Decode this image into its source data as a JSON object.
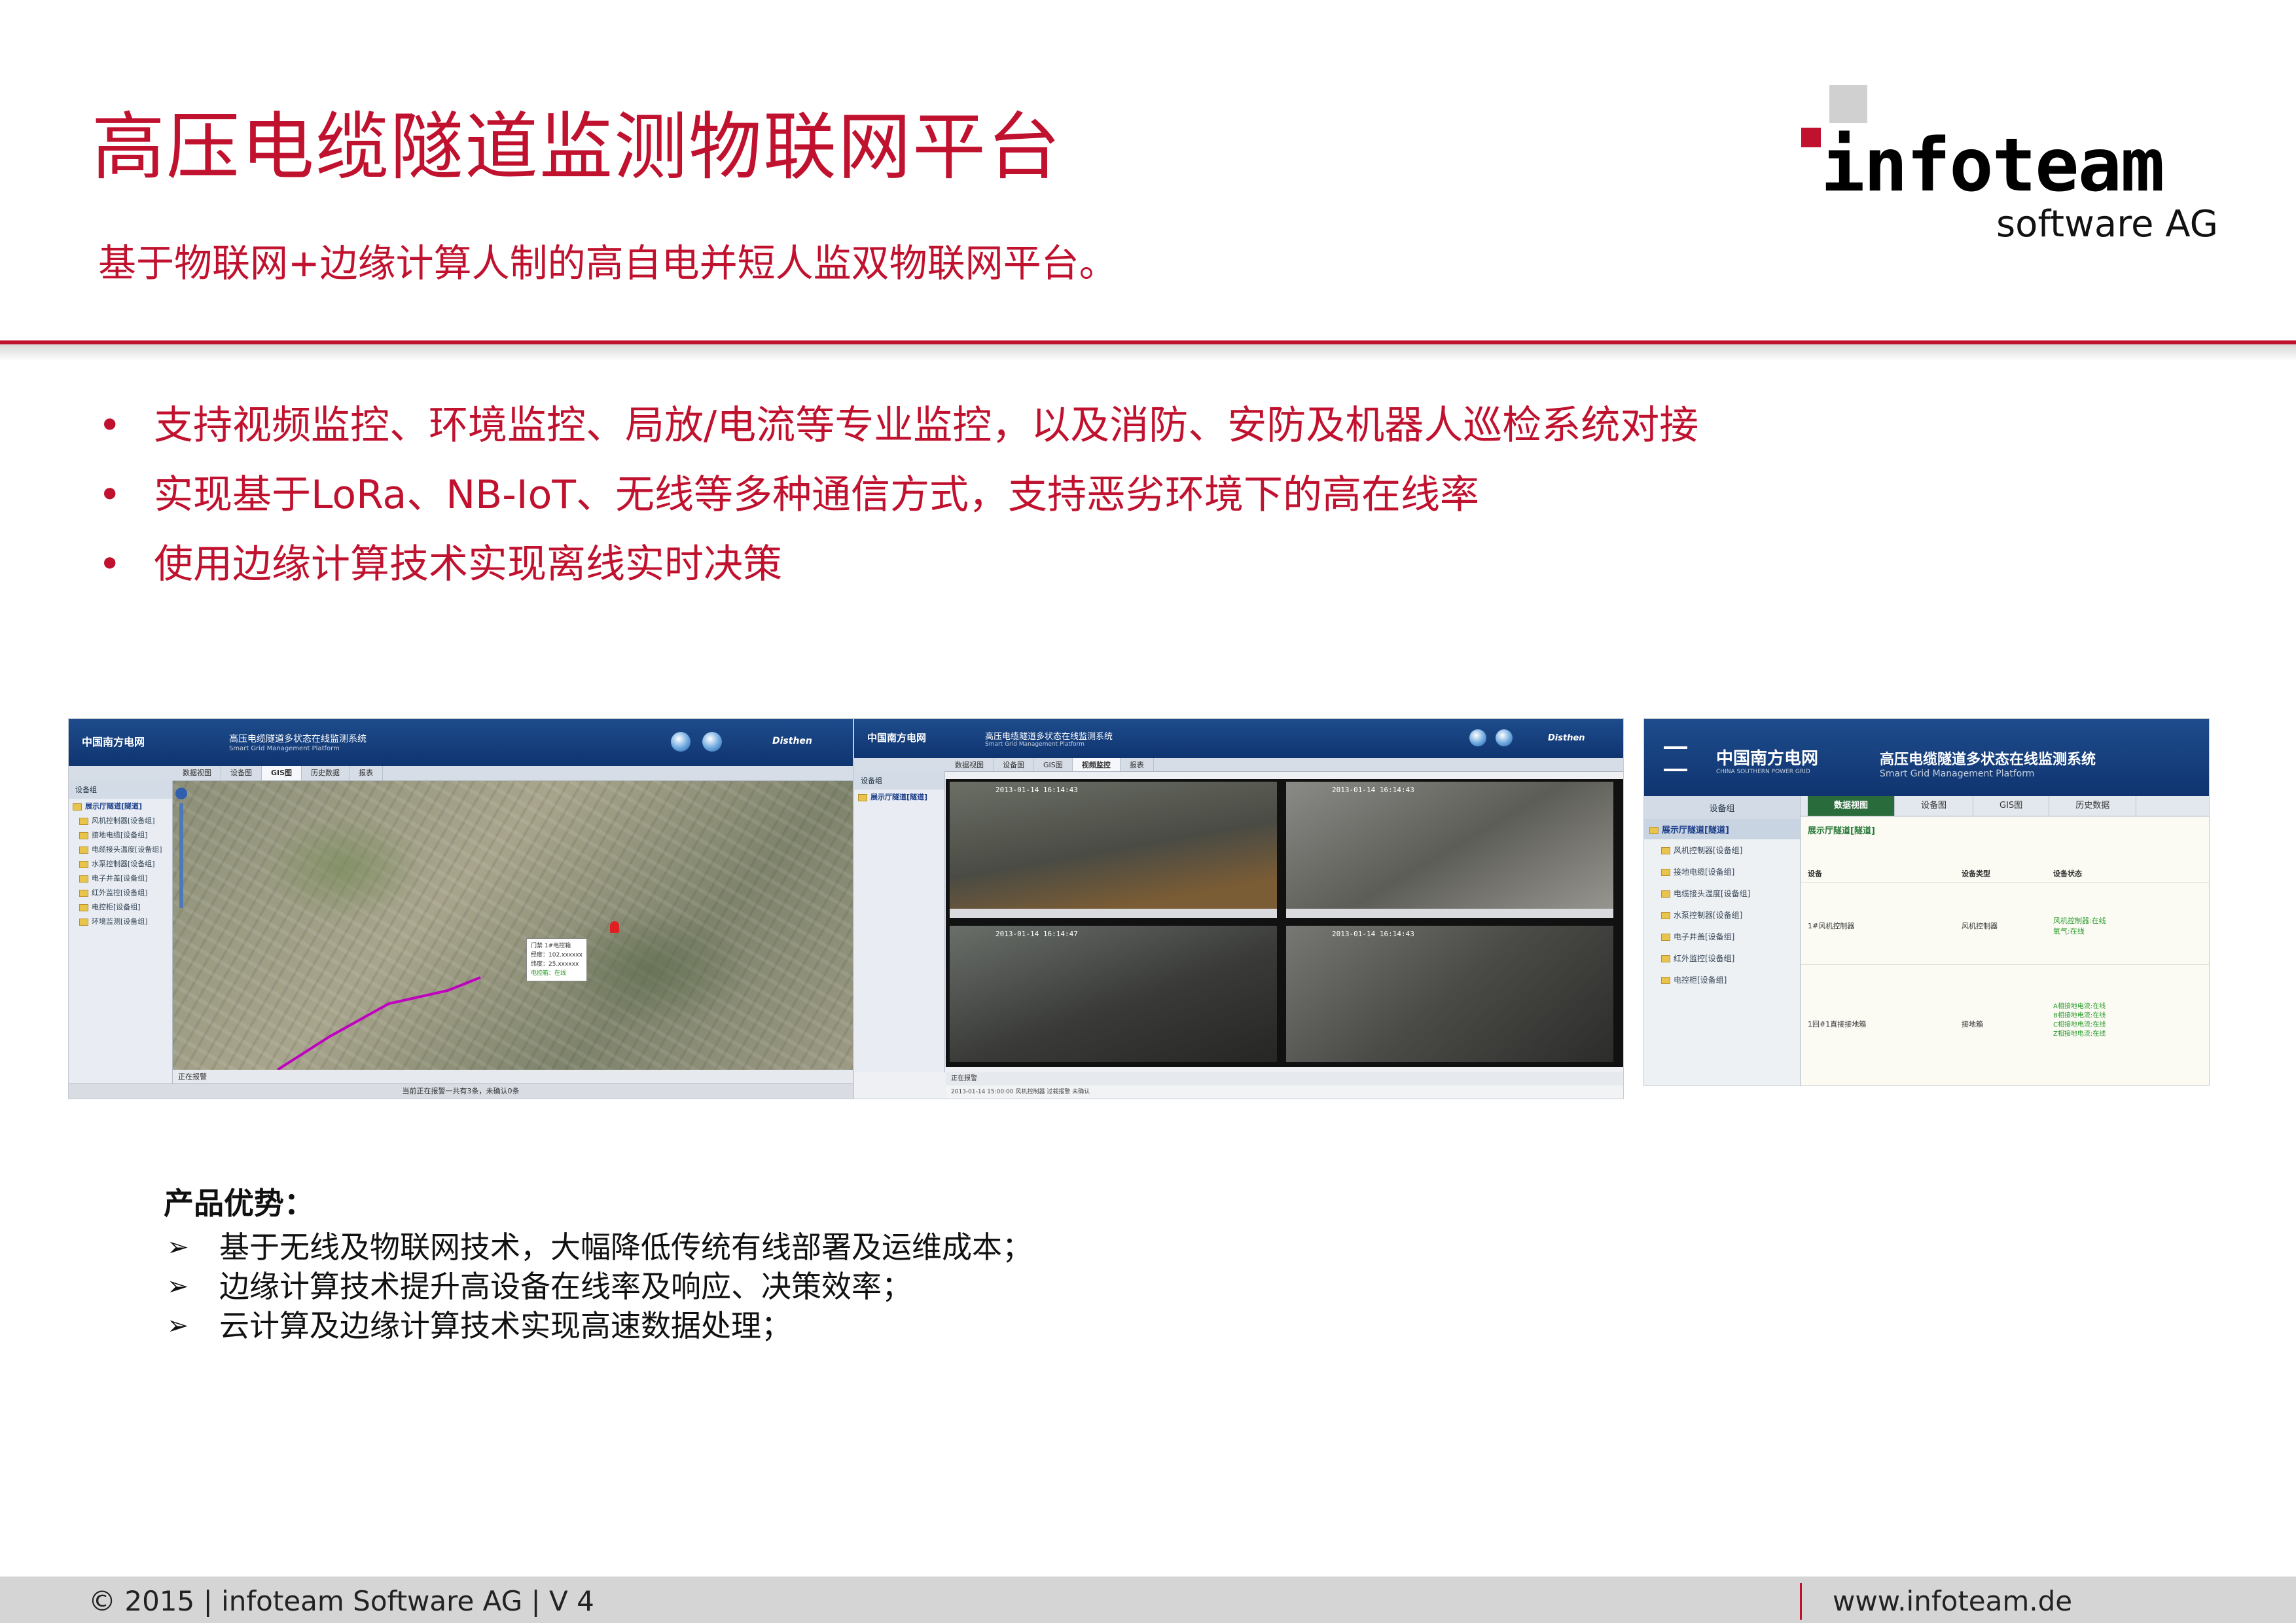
{
  "header": {
    "title": "高压电缆隧道监测物联网平台",
    "subtitle": "基于物联网+边缘计算人制的高自电并短人监双物联网平台。"
  },
  "logo": {
    "wordmark": "infoteam",
    "subtitle": "software AG"
  },
  "bullets": [
    {
      "marker": "•",
      "text": "支持视频监控、环境监控、局放/电流等专业监控，以及消防、安防及机器人巡检系统对接"
    },
    {
      "marker": "•",
      "text": "实现基于LoRa、NB-IoT、无线等多种通信方式，支持恶劣环境下的高在线率"
    },
    {
      "marker": "•",
      "text": "使用边缘计算技术实现离线实时决策"
    }
  ],
  "screenshots": [
    {
      "org": "中国南方电网",
      "system": "高压电缆隧道多状态在线监测系统",
      "system_en": "Smart Grid Management Platform",
      "brand": "Disthen",
      "tabs": [
        "数据视图",
        "设备图",
        "GIS图",
        "历史数据",
        "报表"
      ],
      "tree_header": "设备组",
      "tree_root": "展示厅隧道[隧道]",
      "tree_items": [
        "风机控制器[设备组]",
        "接地电缆[设备组]",
        "电缆接头温度[设备组]",
        "水泵控制器[设备组]",
        "电子井盖[设备组]",
        "红外监控[设备组]",
        "电控柜[设备组]",
        "环境监测[设备组]"
      ],
      "popup_lines": [
        "门禁 1#电控箱",
        "经度：102.xxxxxx",
        "纬度：25.xxxxxx",
        "电控箱：在线"
      ],
      "status": "当前正在报警一共有3条，未确认0条",
      "status_left": "正在报警"
    },
    {
      "org": "中国南方电网",
      "system": "高压电缆隧道多状态在线监测系统",
      "system_en": "Smart Grid Management Platform",
      "brand": "Disthen",
      "tabs": [
        "数据视图",
        "设备图",
        "GIS图",
        "视频监控",
        "报表"
      ],
      "tree_header": "设备组",
      "tree_root": "展示厅隧道[隧道]",
      "video_timestamps": [
        "2013-01-14 16:14:43",
        "2013-01-14 16:14:43",
        "2013-01-14 16:14:47",
        "2013-01-14 16:14:43"
      ],
      "status_left": "正在报警",
      "status": "2013-01-14 15:00:00 风机控制器 过载报警 未确认"
    },
    {
      "org": "中国南方电网",
      "org_en": "CHINA SOUTHERN POWER GRID",
      "system": "高压电缆隧道多状态在线监测系统",
      "system_en": "Smart Grid Management Platform",
      "tabs": [
        "数据视图",
        "设备图",
        "GIS图",
        "历史数据"
      ],
      "tree_header": "设备组",
      "tree_root": "展示厅隧道[隧道]",
      "tree_items": [
        "风机控制器[设备组]",
        "接地电缆[设备组]",
        "电缆接头温度[设备组]",
        "水泵控制器[设备组]",
        "电子井盖[设备组]",
        "红外监控[设备组]",
        "电控柜[设备组]"
      ],
      "panel_title": "展示厅隧道[隧道]",
      "columns": [
        "设备",
        "设备类型",
        "设备状态"
      ],
      "rows": [
        {
          "name": "1#风机控制器",
          "type": "风机控制器",
          "status": [
            "风机控制器:在线",
            "氧气:在线"
          ]
        },
        {
          "name": "1回#1直接接地箱",
          "type": "接地箱",
          "status": [
            "A相接地电流:在线",
            "B相接地电流:在线",
            "C相接地电流:在线",
            "Z相接地电流:在线"
          ]
        }
      ]
    }
  ],
  "advantages": {
    "title": "产品优势：",
    "items": [
      {
        "marker": "➢",
        "text": "基于无线及物联网技术，大幅降低传统有线部署及运维成本；"
      },
      {
        "marker": "➢",
        "text": "边缘计算技术提升高设备在线率及响应、决策效率；"
      },
      {
        "marker": "➢",
        "text": "云计算及边缘计算技术实现高速数据处理；"
      }
    ]
  },
  "footer": {
    "left": "© 2015 | infoteam Software AG | V 4",
    "right": "www.infoteam.de"
  },
  "colors": {
    "accent": "#c0122f",
    "banner": "#1e4c8c",
    "footer_bg": "#d5d5d5"
  }
}
